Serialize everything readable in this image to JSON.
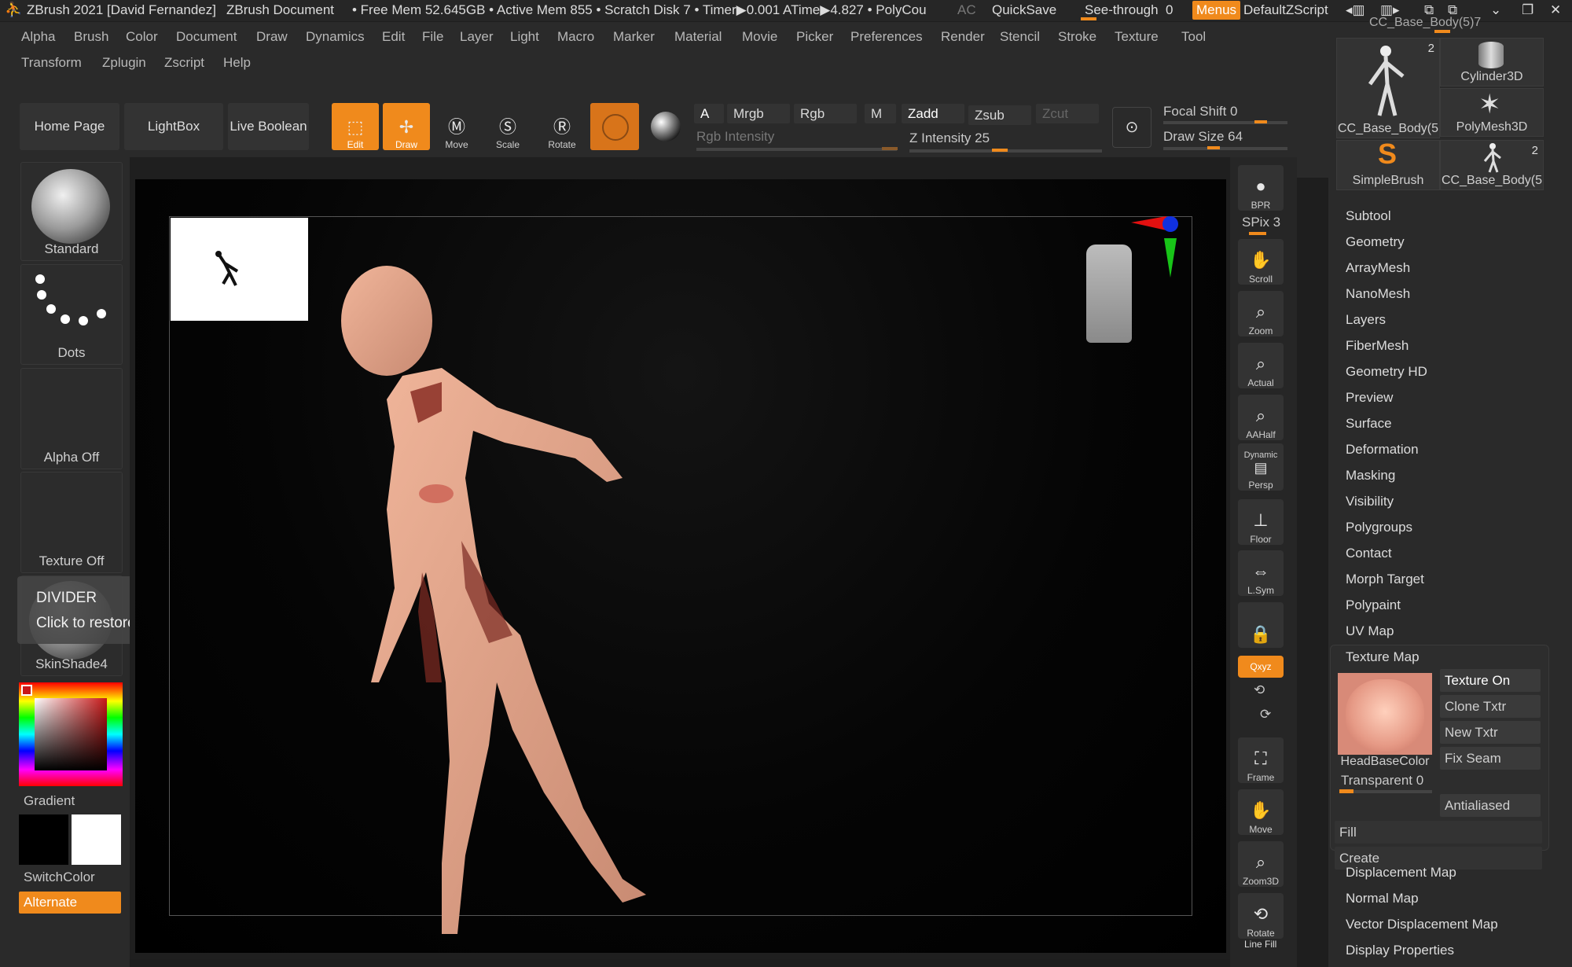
{
  "titlebar": {
    "app": "ZBrush 2021 [David Fernandez]",
    "document": "ZBrush Document",
    "stats": "• Free Mem 52.645GB • Active Mem 855 • Scratch Disk 7 • Timer▶0.001 ATime▶4.827 • PolyCou",
    "ac": "AC",
    "quicksave": "QuickSave",
    "seethrough": "See-through",
    "seethrough_val": "0",
    "menus": "Menus",
    "script": "DefaultZScript"
  },
  "menubar": {
    "row1": [
      "Alpha",
      "Brush",
      "Color",
      "Document",
      "Draw",
      "Dynamics",
      "Edit",
      "File",
      "Layer",
      "Light",
      "Macro",
      "Marker",
      "Material",
      "Movie",
      "Picker",
      "Preferences",
      "Render",
      "Stencil",
      "Stroke",
      "Texture",
      "Tool"
    ],
    "row2": [
      "Transform",
      "Zplugin",
      "Zscript",
      "Help"
    ]
  },
  "toolbar": {
    "home": "Home Page",
    "lightbox": "LightBox",
    "liveboolean": "Live Boolean",
    "edit": "Edit",
    "draw": "Draw",
    "move": "Move",
    "scale": "Scale",
    "rotate": "Rotate",
    "a": "A",
    "mrgb": "Mrgb",
    "rgb": "Rgb",
    "m": "M",
    "zadd": "Zadd",
    "zsub": "Zsub",
    "zcut": "Zcut",
    "rgb_intensity": "Rgb Intensity",
    "z_intensity": "Z Intensity 25",
    "focal_shift": "Focal Shift 0",
    "draw_size": "Draw Size 64"
  },
  "left": {
    "brush": "Standard",
    "stroke": "Dots",
    "alpha": "Alpha Off",
    "texture": "Texture Off",
    "material": "SkinShade4",
    "gradient": "Gradient",
    "switchcolor": "SwitchColor",
    "alternate": "Alternate"
  },
  "tooltip": {
    "title": "DIVIDER",
    "body": "Click to restore previous position."
  },
  "vstrip": {
    "bpr": "BPR",
    "spix": "SPix 3",
    "scroll": "Scroll",
    "zoom": "Zoom",
    "actual": "Actual",
    "aahalf": "AAHalf",
    "dynamic": "Dynamic",
    "persp": "Persp",
    "floor": "Floor",
    "lsym": "L.Sym",
    "xyz": "Qxyz",
    "frame": "Frame",
    "move": "Move",
    "zoom3d": "Zoom3D",
    "rotate": "Rotate",
    "linefill": "Line Fill"
  },
  "palette": {
    "thumbs": [
      {
        "label": "CC_Base_Body(5",
        "count": "2"
      },
      {
        "label": "Cylinder3D",
        "count": ""
      },
      {
        "label": "PolyMesh3D",
        "count": ""
      },
      {
        "label": "SimpleBrush",
        "count": ""
      },
      {
        "label": "CC_Base_Body(5",
        "count": "2"
      }
    ],
    "top_label": "CC_Base_Body(5)7",
    "items_a": [
      "Subtool",
      "Geometry",
      "ArrayMesh",
      "NanoMesh",
      "Layers",
      "FiberMesh",
      "Geometry HD",
      "Preview",
      "Surface",
      "Deformation",
      "Masking",
      "Visibility",
      "Polygroups",
      "Contact",
      "Morph Target",
      "Polypaint",
      "UV Map"
    ],
    "texture_map": "Texture Map",
    "texture_on": "Texture On",
    "clone_txtr": "Clone Txtr",
    "new_txtr": "New Txtr",
    "fix_seam": "Fix Seam",
    "antialiased": "Antialiased",
    "headbase": "HeadBaseColor",
    "transparent": "Transparent 0",
    "fill": "Fill",
    "create": "Create",
    "items_b": [
      "Displacement Map",
      "Normal Map",
      "Vector Displacement Map",
      "Display Properties"
    ]
  }
}
